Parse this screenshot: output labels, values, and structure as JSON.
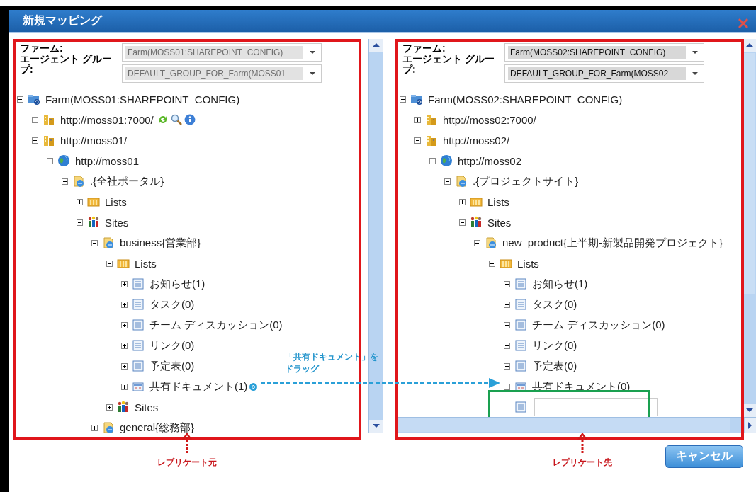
{
  "window": {
    "title": "新規マッピング"
  },
  "panes": [
    {
      "disabled": true,
      "farm_label": "ファーム:",
      "group_label": "エージェント グループ:",
      "farm_value": "Farm(MOSS01:SHAREPOINT_CONFIG)",
      "group_value": "DEFAULT_GROUP_FOR_Farm(MOSS01",
      "caption": "レプリケート元",
      "tree": [
        {
          "label": "Farm(MOSS01:SHAREPOINT_CONFIG)",
          "kind": "farm",
          "expanded": true,
          "children": [
            {
              "label": "http://moss01:7000/",
              "kind": "webapp",
              "expanded": false,
              "hovered": true
            },
            {
              "label": "http://moss01/",
              "kind": "webapp",
              "expanded": true,
              "children": [
                {
                  "label": "http://moss01",
                  "kind": "globe",
                  "expanded": true,
                  "children": [
                    {
                      "label": ".{全社ポータル}",
                      "kind": "site",
                      "expanded": true,
                      "children": [
                        {
                          "label": "Lists",
                          "kind": "lists",
                          "expanded": false
                        },
                        {
                          "label": "Sites",
                          "kind": "sites",
                          "expanded": true,
                          "children": [
                            {
                              "label": "business{営業部}",
                              "kind": "site",
                              "expanded": true,
                              "children": [
                                {
                                  "label": "Lists",
                                  "kind": "lists",
                                  "expanded": true,
                                  "children": [
                                    {
                                      "label": "お知らせ(1)",
                                      "kind": "list",
                                      "expanded": false
                                    },
                                    {
                                      "label": "タスク(0)",
                                      "kind": "list",
                                      "expanded": false
                                    },
                                    {
                                      "label": "チーム ディスカッション(0)",
                                      "kind": "list",
                                      "expanded": false
                                    },
                                    {
                                      "label": "リンク(0)",
                                      "kind": "list",
                                      "expanded": false
                                    },
                                    {
                                      "label": "予定表(0)",
                                      "kind": "list",
                                      "expanded": false
                                    },
                                    {
                                      "label": "共有ドキュメント(1)",
                                      "kind": "doclib",
                                      "expanded": false,
                                      "drag_source": true
                                    }
                                  ]
                                },
                                {
                                  "label": "Sites",
                                  "kind": "sites",
                                  "expanded": false
                                }
                              ]
                            },
                            {
                              "label": "general{総務部}",
                              "kind": "site",
                              "expanded": false
                            }
                          ]
                        }
                      ]
                    }
                  ]
                }
              ]
            }
          ]
        }
      ]
    },
    {
      "disabled": false,
      "farm_label": "ファーム:",
      "group_label": "エージェント グループ:",
      "farm_value": "Farm(MOSS02:SHAREPOINT_CONFIG)",
      "group_value": "DEFAULT_GROUP_FOR_Farm(MOSS02",
      "caption": "レプリケート先",
      "tree": [
        {
          "label": "Farm(MOSS02:SHAREPOINT_CONFIG)",
          "kind": "farm",
          "expanded": true,
          "children": [
            {
              "label": "http://moss02:7000/",
              "kind": "webapp",
              "expanded": false
            },
            {
              "label": "http://moss02/",
              "kind": "webapp",
              "expanded": true,
              "children": [
                {
                  "label": "http://moss02",
                  "kind": "globe",
                  "expanded": true,
                  "children": [
                    {
                      "label": ".{プロジェクトサイト}",
                      "kind": "site",
                      "expanded": true,
                      "children": [
                        {
                          "label": "Lists",
                          "kind": "lists",
                          "expanded": false
                        },
                        {
                          "label": "Sites",
                          "kind": "sites",
                          "expanded": true,
                          "children": [
                            {
                              "label": "new_product{上半期-新製品開発プロジェクト}",
                              "kind": "site",
                              "expanded": true,
                              "children": [
                                {
                                  "label": "Lists",
                                  "kind": "lists",
                                  "expanded": true,
                                  "children": [
                                    {
                                      "label": "お知らせ(1)",
                                      "kind": "list",
                                      "expanded": false
                                    },
                                    {
                                      "label": "タスク(0)",
                                      "kind": "list",
                                      "expanded": false
                                    },
                                    {
                                      "label": "チーム ディスカッション(0)",
                                      "kind": "list",
                                      "expanded": false
                                    },
                                    {
                                      "label": "リンク(0)",
                                      "kind": "list",
                                      "expanded": false
                                    },
                                    {
                                      "label": "予定表(0)",
                                      "kind": "list",
                                      "expanded": false
                                    },
                                    {
                                      "label": "共有ドキュメント(0)",
                                      "kind": "doclib",
                                      "expanded": false
                                    },
                                    {
                                      "kind": "new"
                                    }
                                  ]
                                }
                              ]
                            }
                          ]
                        }
                      ]
                    }
                  ]
                }
              ]
            }
          ]
        }
      ]
    }
  ],
  "drag_caption": [
    "「共有ドキュメント」を",
    "ドラッグ"
  ],
  "buttons": [
    "キャンセル"
  ]
}
